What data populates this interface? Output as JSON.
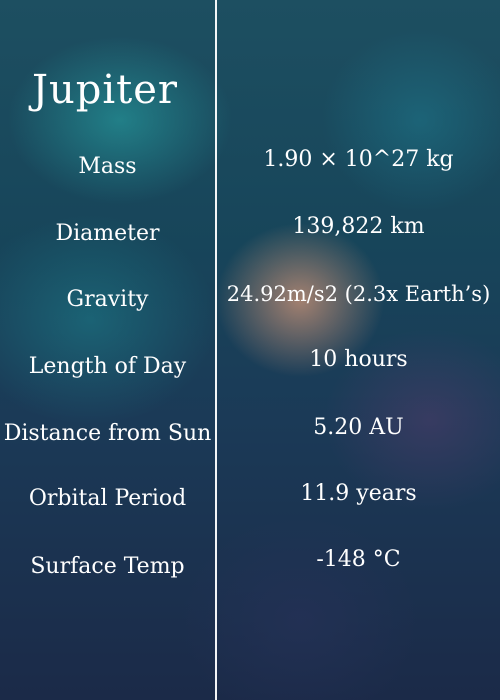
{
  "planet": {
    "name": "Jupiter"
  },
  "facts": [
    {
      "label": "Mass",
      "value": "1.90 × 10^27 kg"
    },
    {
      "label": "Diameter",
      "value": "139,822 km"
    },
    {
      "label": "Gravity",
      "value": "24.92m/s2 (2.3x Earth’s)"
    },
    {
      "label": "Length of Day",
      "value": "10 hours"
    },
    {
      "label": "Distance from Sun",
      "value": "5.20 AU"
    },
    {
      "label": "Orbital Period",
      "value": "11.9 years"
    },
    {
      "label": "Surface Temp",
      "value": "-148 °C"
    }
  ]
}
